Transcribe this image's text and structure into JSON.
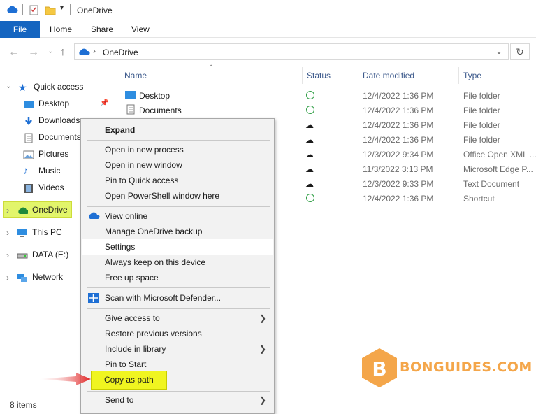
{
  "window": {
    "title": "OneDrive"
  },
  "ribbon": {
    "tabs": [
      "File",
      "Home",
      "Share",
      "View"
    ]
  },
  "address": {
    "path": "OneDrive"
  },
  "nav": {
    "quick_access": "Quick access",
    "items": [
      "Desktop",
      "Downloads",
      "Documents",
      "Pictures",
      "Music",
      "Videos"
    ],
    "onedrive": "OneDrive",
    "this_pc": "This PC",
    "data": "DATA (E:)",
    "network": "Network"
  },
  "columns": {
    "name": "Name",
    "status": "Status",
    "date": "Date modified",
    "type": "Type"
  },
  "files": [
    {
      "name": "Desktop",
      "status": "ok",
      "date": "12/4/2022 1:36 PM",
      "type": "File folder"
    },
    {
      "name": "Documents",
      "status": "ok",
      "date": "12/4/2022 1:36 PM",
      "type": "File folder"
    },
    {
      "name": "",
      "status": "cloud",
      "date": "12/4/2022 1:36 PM",
      "type": "File folder"
    },
    {
      "name": "",
      "status": "cloud",
      "date": "12/4/2022 1:36 PM",
      "type": "File folder"
    },
    {
      "name": "",
      "status": "cloud",
      "date": "12/3/2022 9:34 PM",
      "type": "Office Open XML ..."
    },
    {
      "name": "",
      "status": "cloud",
      "date": "11/3/2022 3:13 PM",
      "type": "Microsoft Edge P..."
    },
    {
      "name": "",
      "status": "cloud",
      "date": "12/3/2022 9:33 PM",
      "type": "Text Document"
    },
    {
      "name": "",
      "status": "ok",
      "date": "12/4/2022 1:36 PM",
      "type": "Shortcut"
    }
  ],
  "status_bar": "8 items",
  "menu": {
    "expand": "Expand",
    "open_new_process": "Open in new process",
    "open_new_window": "Open in new window",
    "pin_quick_access": "Pin to Quick access",
    "open_powershell": "Open PowerShell window here",
    "view_online": "View online",
    "manage_backup": "Manage OneDrive backup",
    "settings": "Settings",
    "always_keep": "Always keep on this device",
    "free_up": "Free up space",
    "scan_defender": "Scan with Microsoft Defender...",
    "give_access": "Give access to",
    "restore_versions": "Restore previous versions",
    "include_library": "Include in library",
    "pin_start": "Pin to Start",
    "copy_as_path": "Copy as path",
    "send_to": "Send to"
  },
  "watermark": {
    "letter": "B",
    "text": "BONGUIDES.COM"
  },
  "colors": {
    "accent": "#1565c0",
    "highlight": "#f0f520",
    "nav_highlight": "#e2f56b",
    "arrow": "#e02020",
    "watermark": "#f4a64a",
    "cloud": "#1e6fd4",
    "ok": "#2e9e44"
  }
}
